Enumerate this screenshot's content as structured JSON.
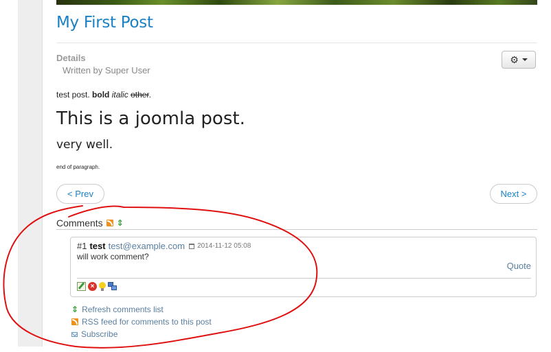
{
  "article": {
    "title": "My First Post",
    "details_label": "Details",
    "written_by": "Written by Super User",
    "body": {
      "prefix": "test post. ",
      "bold": "bold",
      "italic": "italic",
      "strike": "other",
      "suffix": ".",
      "heading_large": "This is a joomla post.",
      "heading_medium": "very well.",
      "small_text": "end of paragraph."
    }
  },
  "pager": {
    "prev_label": "< Prev",
    "next_label": "Next >"
  },
  "comments": {
    "heading": "Comments",
    "items": [
      {
        "number": "#1",
        "author": "test",
        "email": "test@example.com",
        "date": "2014-11-12 05:08",
        "text": "will work comment?",
        "quote_label": "Quote"
      }
    ],
    "links": {
      "refresh": "Refresh comments list",
      "rss": "RSS feed for comments to this post",
      "subscribe": "Subscribe"
    }
  },
  "colors": {
    "link_blue": "#1a82c4",
    "annotation_red": "#e01010"
  }
}
